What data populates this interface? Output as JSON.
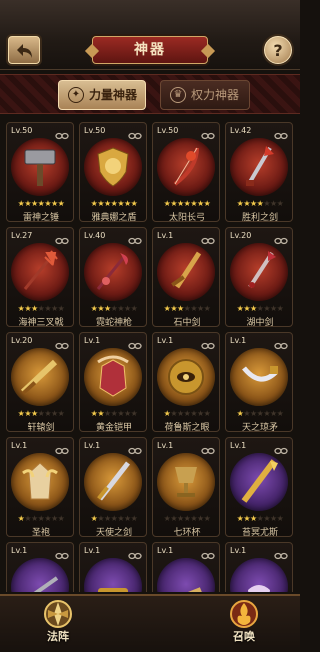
{
  "header": {
    "title": "神器"
  },
  "tabs": [
    {
      "label": "力量神器",
      "active": true
    },
    {
      "label": "权力神器",
      "active": false
    }
  ],
  "artifacts": [
    {
      "level": "Lv.50",
      "name": "雷神之锤",
      "stars": 7,
      "bg": "red"
    },
    {
      "level": "Lv.50",
      "name": "雅典娜之盾",
      "stars": 7,
      "bg": "red"
    },
    {
      "level": "Lv.50",
      "name": "太阳长弓",
      "stars": 7,
      "bg": "red"
    },
    {
      "level": "Lv.42",
      "name": "胜利之剑",
      "stars": 4,
      "bg": "red"
    },
    {
      "level": "Lv.27",
      "name": "海神三叉戟",
      "stars": 3,
      "bg": "red"
    },
    {
      "level": "Lv.40",
      "name": "霓蛇神枪",
      "stars": 3,
      "bg": "red"
    },
    {
      "level": "Lv.1",
      "name": "石中剑",
      "stars": 3,
      "bg": "red"
    },
    {
      "level": "Lv.20",
      "name": "湖中剑",
      "stars": 3,
      "bg": "red"
    },
    {
      "level": "Lv.20",
      "name": "轩辕剑",
      "stars": 3,
      "bg": "gold"
    },
    {
      "level": "Lv.1",
      "name": "黄金铠甲",
      "stars": 2,
      "bg": "gold"
    },
    {
      "level": "Lv.1",
      "name": "荷鲁斯之眼",
      "stars": 1,
      "bg": "gold"
    },
    {
      "level": "Lv.1",
      "name": "天之琼矛",
      "stars": 1,
      "bg": "gold"
    },
    {
      "level": "Lv.1",
      "name": "圣袍",
      "stars": 1,
      "bg": "gold"
    },
    {
      "level": "Lv.1",
      "name": "天使之剑",
      "stars": 1,
      "bg": "gold"
    },
    {
      "level": "Lv.1",
      "name": "七环杯",
      "stars": 0,
      "bg": "gold"
    },
    {
      "level": "Lv.1",
      "name": "苔冥尤斯",
      "stars": 3,
      "bg": "purple"
    },
    {
      "level": "Lv.1",
      "name": "",
      "stars": 0,
      "bg": "purple"
    },
    {
      "level": "Lv.1",
      "name": "",
      "stars": 0,
      "bg": "purple"
    },
    {
      "level": "Lv.1",
      "name": "",
      "stars": 0,
      "bg": "purple"
    },
    {
      "level": "Lv.1",
      "name": "",
      "stars": 0,
      "bg": "purple"
    }
  ],
  "bottom_nav": {
    "left_label": "法阵",
    "right_label": "召唤"
  },
  "colors": {
    "star_on": "#f2c94c",
    "star_off": "#3f342a",
    "title_plate": "#8a231d",
    "tab_active": "#d8bd92"
  }
}
